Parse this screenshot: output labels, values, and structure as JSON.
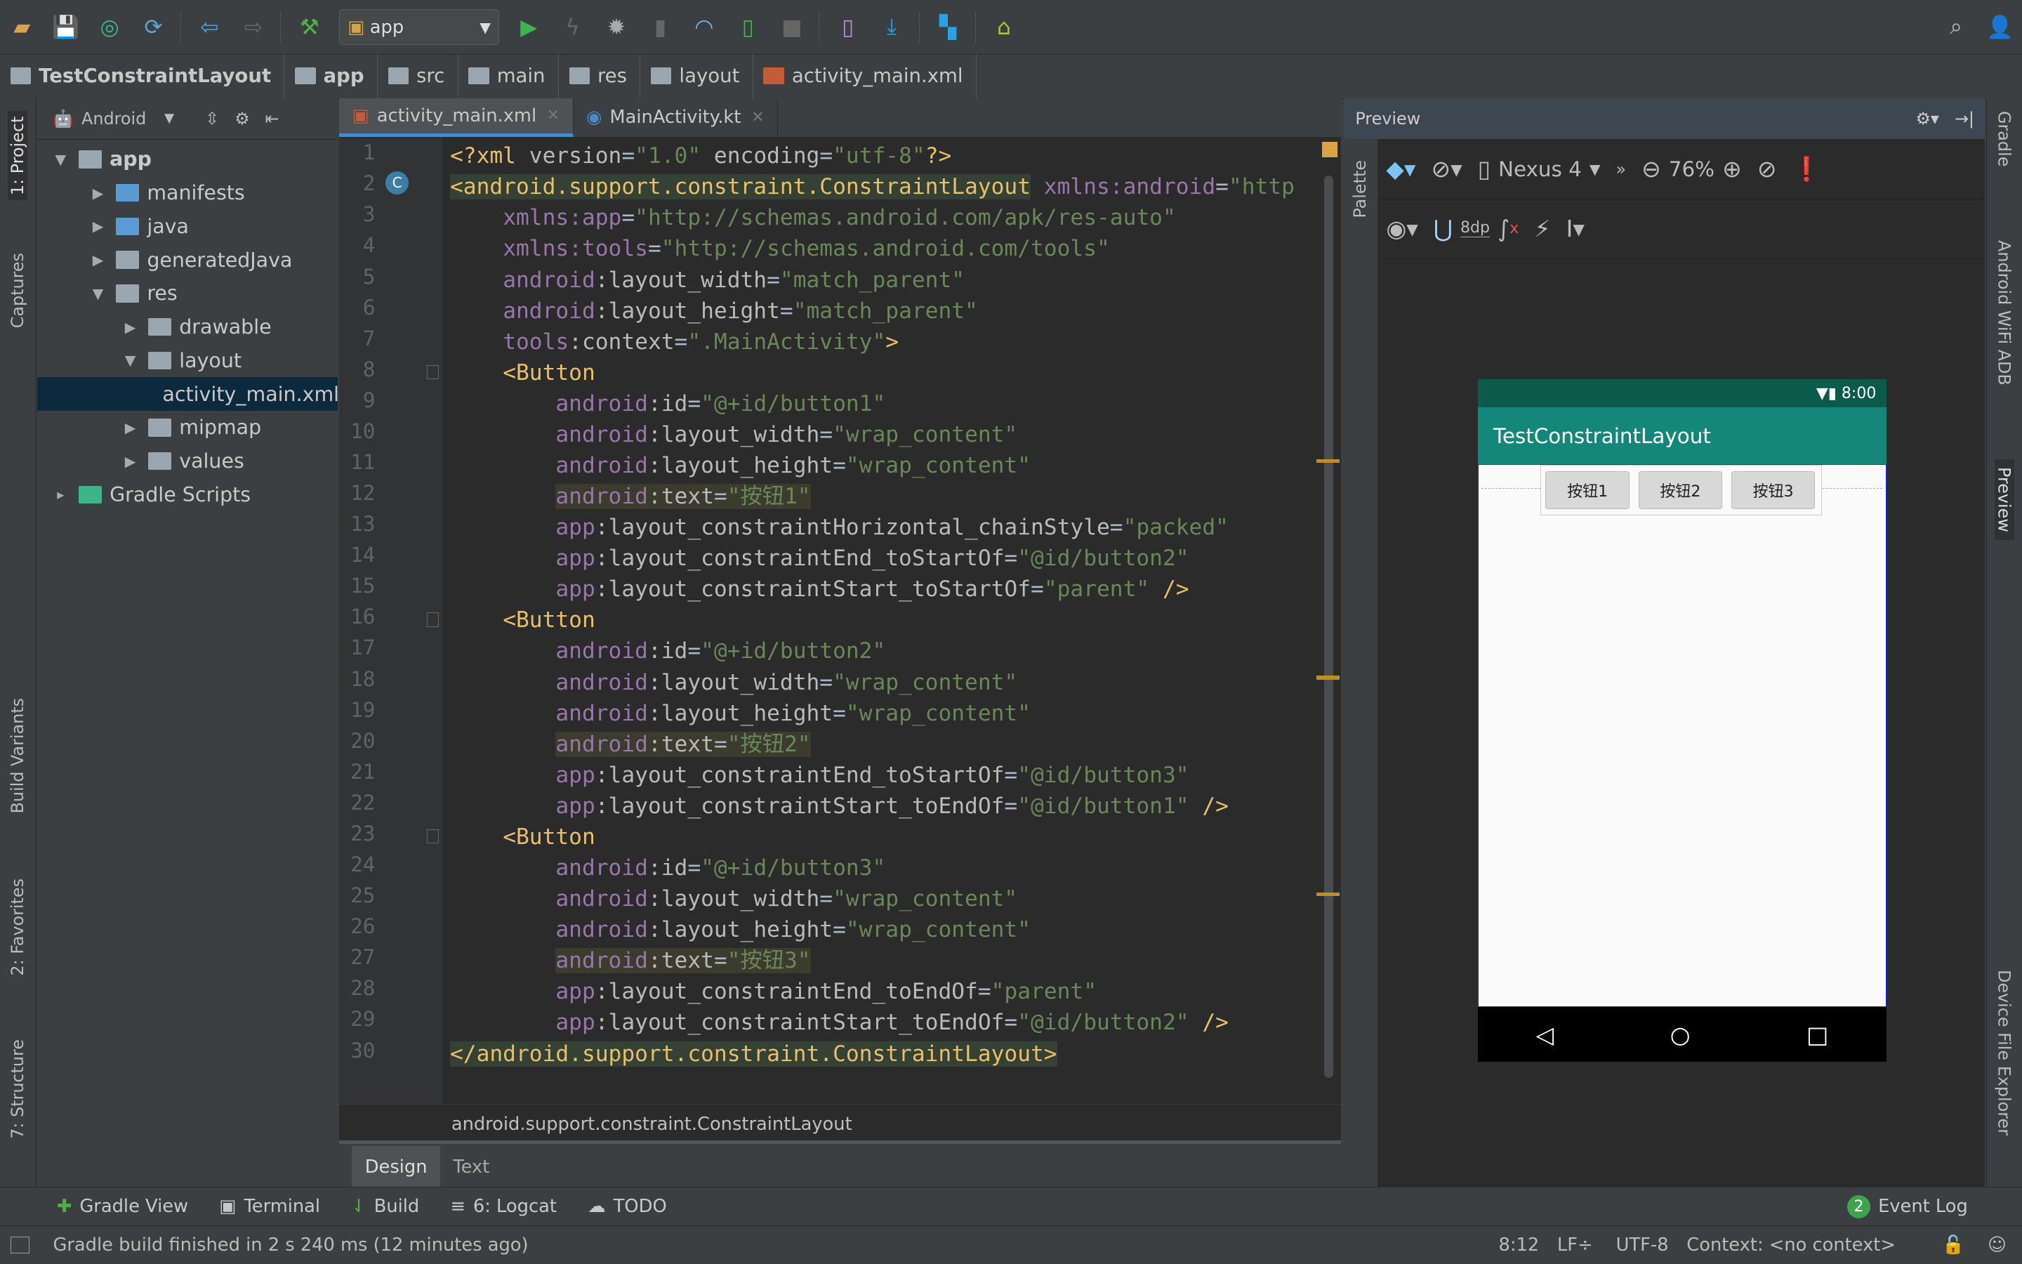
{
  "toolbar": {
    "run_config": "app"
  },
  "breadcrumbs": [
    "TestConstraintLayout",
    "app",
    "src",
    "main",
    "res",
    "layout",
    "activity_main.xml"
  ],
  "left_strip": [
    "1: Project",
    "Captures",
    "Build Variants",
    "2: Favorites",
    "7: Structure"
  ],
  "right_strip": [
    "Gradle",
    "Android WiFi ADB",
    "Preview",
    "Device File Explorer"
  ],
  "project": {
    "view": "Android",
    "tree": [
      {
        "label": "app",
        "level": 0,
        "arrow": "▼",
        "bold": true
      },
      {
        "label": "manifests",
        "level": 1,
        "arrow": "▶"
      },
      {
        "label": "java",
        "level": 1,
        "arrow": "▶"
      },
      {
        "label": "generatedJava",
        "level": 1,
        "arrow": "▶"
      },
      {
        "label": "res",
        "level": 1,
        "arrow": "▼"
      },
      {
        "label": "drawable",
        "level": 2,
        "arrow": "▶"
      },
      {
        "label": "layout",
        "level": 2,
        "arrow": "▼"
      },
      {
        "label": "activity_main.xml",
        "level": 3,
        "arrow": "",
        "selected": true
      },
      {
        "label": "mipmap",
        "level": 2,
        "arrow": "▶"
      },
      {
        "label": "values",
        "level": 2,
        "arrow": "▶"
      },
      {
        "label": "Gradle Scripts",
        "level": 0,
        "arrow": "▸"
      }
    ]
  },
  "editor": {
    "tabs": [
      {
        "label": "activity_main.xml",
        "active": true
      },
      {
        "label": "MainActivity.kt",
        "active": false
      }
    ],
    "lines": [
      [
        [
          "tag",
          "<?xml "
        ],
        [
          "attr",
          "version"
        ],
        [
          "plain",
          "="
        ],
        [
          "str",
          "\"1.0\""
        ],
        [
          "attr",
          " encoding"
        ],
        [
          "plain",
          "="
        ],
        [
          "str",
          "\"utf-8\""
        ],
        [
          "tag",
          "?>"
        ]
      ],
      [
        [
          "tag",
          "<android.support.constraint.ConstraintLayout"
        ],
        [
          "plain",
          " "
        ],
        [
          "ns",
          "xmlns:android"
        ],
        [
          "plain",
          "="
        ],
        [
          "str",
          "\"http"
        ]
      ],
      [
        [
          "plain",
          "    "
        ],
        [
          "ns",
          "xmlns:app"
        ],
        [
          "plain",
          "="
        ],
        [
          "str",
          "\"http://schemas.android.com/apk/res-auto\""
        ]
      ],
      [
        [
          "plain",
          "    "
        ],
        [
          "ns",
          "xmlns:tools"
        ],
        [
          "plain",
          "="
        ],
        [
          "str",
          "\"http://schemas.android.com/tools\""
        ]
      ],
      [
        [
          "plain",
          "    "
        ],
        [
          "ns",
          "android"
        ],
        [
          "attr",
          ":layout_width"
        ],
        [
          "plain",
          "="
        ],
        [
          "str",
          "\"match_parent\""
        ]
      ],
      [
        [
          "plain",
          "    "
        ],
        [
          "ns",
          "android"
        ],
        [
          "attr",
          ":layout_height"
        ],
        [
          "plain",
          "="
        ],
        [
          "str",
          "\"match_parent\""
        ]
      ],
      [
        [
          "plain",
          "    "
        ],
        [
          "ns",
          "tools"
        ],
        [
          "attr",
          ":context"
        ],
        [
          "plain",
          "="
        ],
        [
          "str",
          "\".MainActivity\""
        ],
        [
          "tag",
          ">"
        ]
      ],
      [
        [
          "plain",
          "    "
        ],
        [
          "tag",
          "<Button"
        ]
      ],
      [
        [
          "plain",
          "        "
        ],
        [
          "ns",
          "android"
        ],
        [
          "attr",
          ":id"
        ],
        [
          "plain",
          "="
        ],
        [
          "str",
          "\"@+id/button1\""
        ]
      ],
      [
        [
          "plain",
          "        "
        ],
        [
          "ns",
          "android"
        ],
        [
          "attr",
          ":layout_width"
        ],
        [
          "plain",
          "="
        ],
        [
          "str",
          "\"wrap_content\""
        ]
      ],
      [
        [
          "plain",
          "        "
        ],
        [
          "ns",
          "android"
        ],
        [
          "attr",
          ":layout_height"
        ],
        [
          "plain",
          "="
        ],
        [
          "str",
          "\"wrap_content\""
        ]
      ],
      [
        [
          "plain",
          "        "
        ],
        [
          "ns hlt",
          "android"
        ],
        [
          "attr hlt",
          ":text"
        ],
        [
          "plain hlt",
          "="
        ],
        [
          "str hlt",
          "\"按钮1\""
        ]
      ],
      [
        [
          "plain",
          "        "
        ],
        [
          "ns",
          "app"
        ],
        [
          "attr",
          ":layout_constraintHorizontal_chainStyle"
        ],
        [
          "plain",
          "="
        ],
        [
          "str",
          "\"packed\""
        ]
      ],
      [
        [
          "plain",
          "        "
        ],
        [
          "ns",
          "app"
        ],
        [
          "attr",
          ":layout_constraintEnd_toStartOf"
        ],
        [
          "plain",
          "="
        ],
        [
          "str",
          "\"@id/button2\""
        ]
      ],
      [
        [
          "plain",
          "        "
        ],
        [
          "ns",
          "app"
        ],
        [
          "attr",
          ":layout_constraintStart_toStartOf"
        ],
        [
          "plain",
          "="
        ],
        [
          "str",
          "\"parent\""
        ],
        [
          "tag",
          " />"
        ]
      ],
      [
        [
          "plain",
          "    "
        ],
        [
          "tag",
          "<Button"
        ]
      ],
      [
        [
          "plain",
          "        "
        ],
        [
          "ns",
          "android"
        ],
        [
          "attr",
          ":id"
        ],
        [
          "plain",
          "="
        ],
        [
          "str",
          "\"@+id/button2\""
        ]
      ],
      [
        [
          "plain",
          "        "
        ],
        [
          "ns",
          "android"
        ],
        [
          "attr",
          ":layout_width"
        ],
        [
          "plain",
          "="
        ],
        [
          "str",
          "\"wrap_content\""
        ]
      ],
      [
        [
          "plain",
          "        "
        ],
        [
          "ns",
          "android"
        ],
        [
          "attr",
          ":layout_height"
        ],
        [
          "plain",
          "="
        ],
        [
          "str",
          "\"wrap_content\""
        ]
      ],
      [
        [
          "plain",
          "        "
        ],
        [
          "ns hlt",
          "android"
        ],
        [
          "attr hlt",
          ":text"
        ],
        [
          "plain hlt",
          "="
        ],
        [
          "str hlt",
          "\"按钮2\""
        ]
      ],
      [
        [
          "plain",
          "        "
        ],
        [
          "ns",
          "app"
        ],
        [
          "attr",
          ":layout_constraintEnd_toStartOf"
        ],
        [
          "plain",
          "="
        ],
        [
          "str",
          "\"@id/button3\""
        ]
      ],
      [
        [
          "plain",
          "        "
        ],
        [
          "ns",
          "app"
        ],
        [
          "attr",
          ":layout_constraintStart_toEndOf"
        ],
        [
          "plain",
          "="
        ],
        [
          "str",
          "\"@id/button1\""
        ],
        [
          "tag",
          " />"
        ]
      ],
      [
        [
          "plain",
          "    "
        ],
        [
          "tag",
          "<Button"
        ]
      ],
      [
        [
          "plain",
          "        "
        ],
        [
          "ns",
          "android"
        ],
        [
          "attr",
          ":id"
        ],
        [
          "plain",
          "="
        ],
        [
          "str",
          "\"@+id/button3\""
        ]
      ],
      [
        [
          "plain",
          "        "
        ],
        [
          "ns",
          "android"
        ],
        [
          "attr",
          ":layout_width"
        ],
        [
          "plain",
          "="
        ],
        [
          "str",
          "\"wrap_content\""
        ]
      ],
      [
        [
          "plain",
          "        "
        ],
        [
          "ns",
          "android"
        ],
        [
          "attr",
          ":layout_height"
        ],
        [
          "plain",
          "="
        ],
        [
          "str",
          "\"wrap_content\""
        ]
      ],
      [
        [
          "plain",
          "        "
        ],
        [
          "ns hlt",
          "android"
        ],
        [
          "attr hlt",
          ":text"
        ],
        [
          "plain hlt",
          "="
        ],
        [
          "str hlt",
          "\"按钮3\""
        ]
      ],
      [
        [
          "plain",
          "        "
        ],
        [
          "ns",
          "app"
        ],
        [
          "attr",
          ":layout_constraintEnd_toEndOf"
        ],
        [
          "plain",
          "="
        ],
        [
          "str",
          "\"parent\""
        ]
      ],
      [
        [
          "plain",
          "        "
        ],
        [
          "ns",
          "app"
        ],
        [
          "attr",
          ":layout_constraintStart_toEndOf"
        ],
        [
          "plain",
          "="
        ],
        [
          "str",
          "\"@id/button2\""
        ],
        [
          "tag",
          " />"
        ]
      ],
      [
        [
          "tag",
          "</android.support.constraint.ConstraintLayout>"
        ]
      ]
    ],
    "breadcrumb": "android.support.constraint.ConstraintLayout",
    "bottom_tabs": [
      "Design",
      "Text"
    ]
  },
  "preview": {
    "title": "Preview",
    "palette": "Palette",
    "device": "Nexus 4",
    "zoom": "76%",
    "margin": "8dp",
    "phone": {
      "time": "8:00",
      "app_title": "TestConstraintLayout",
      "buttons": [
        "按钮1",
        "按钮2",
        "按钮3"
      ]
    }
  },
  "bottom_tabs": [
    "Gradle View",
    "Terminal",
    "Build",
    "6: Logcat",
    "TODO"
  ],
  "event_log": {
    "label": "Event Log",
    "count": "2"
  },
  "status": {
    "message": "Gradle build finished in 2 s 240 ms (12 minutes ago)",
    "position": "8:12",
    "line_sep": "LF÷",
    "encoding": "UTF-8",
    "context": "Context: <no context>"
  }
}
